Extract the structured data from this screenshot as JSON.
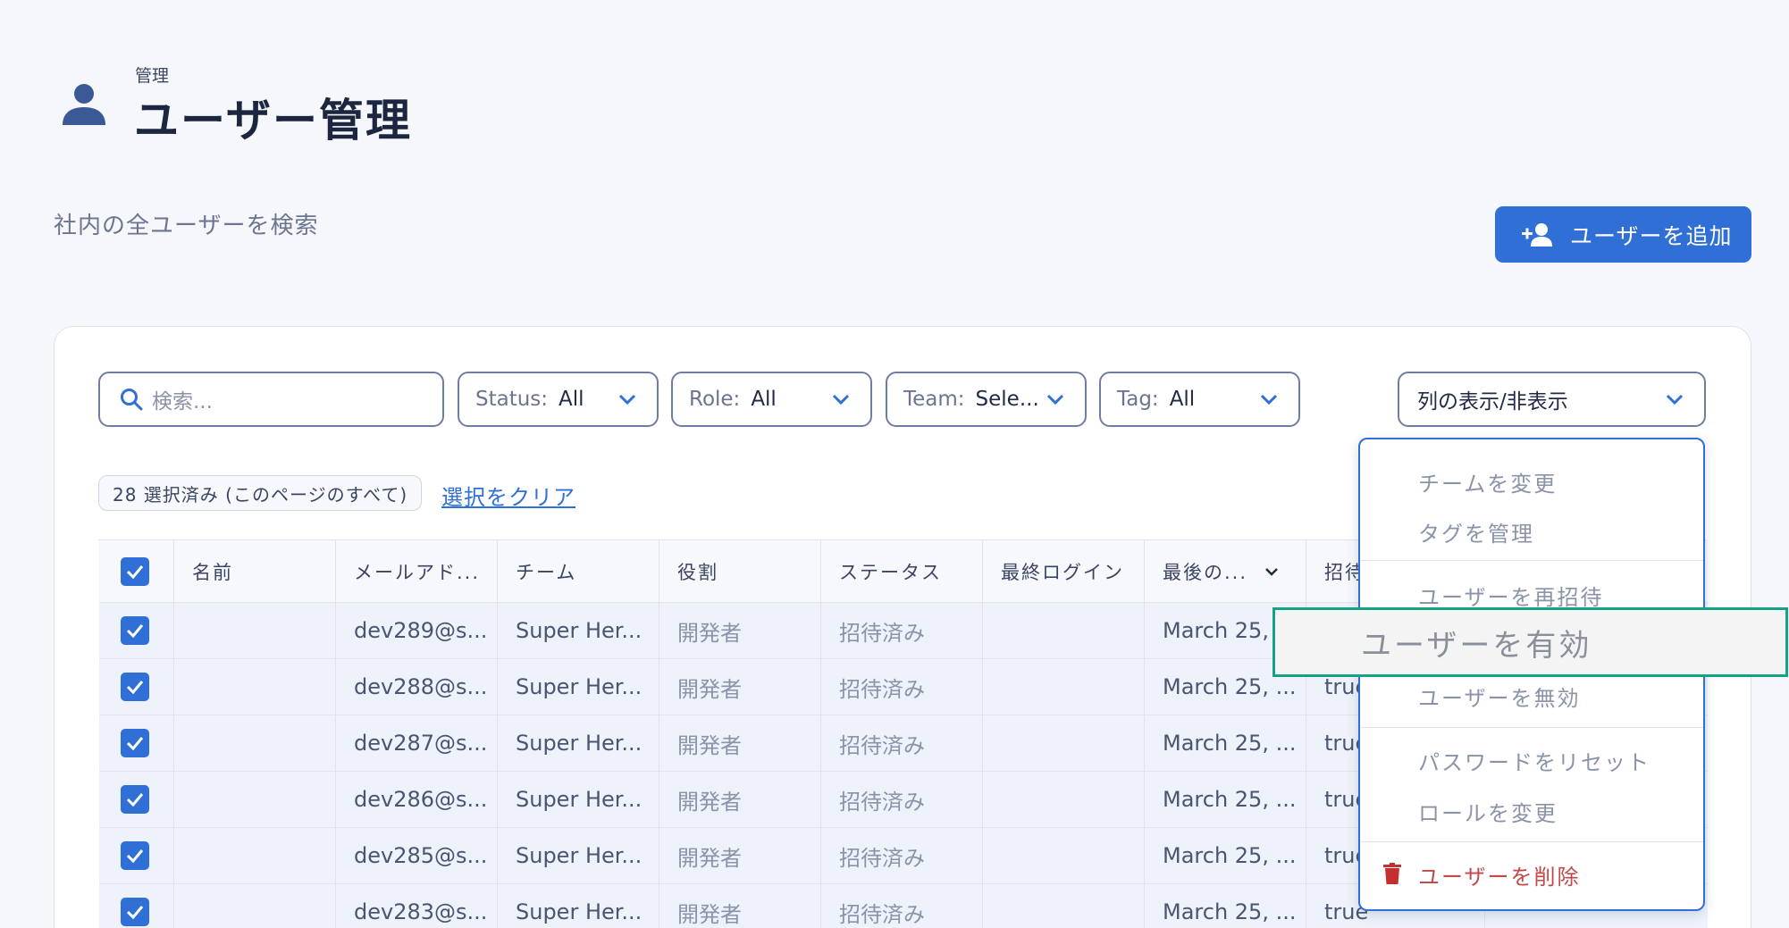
{
  "header": {
    "breadcrumb": "管理",
    "title": "ユーザー管理",
    "subtitle": "社内の全ユーザーを検索",
    "add_button_label": "ユーザーを追加",
    "icon": "user-icon"
  },
  "toolbar": {
    "search_placeholder": "検索...",
    "filters": [
      {
        "label": "Status:",
        "value": "All"
      },
      {
        "label": "Role:",
        "value": "All"
      },
      {
        "label": "Team:",
        "value": "Sele..."
      },
      {
        "label": "Tag:",
        "value": "All"
      }
    ],
    "columns_toggle_label": "列の表示/非表示"
  },
  "selection": {
    "badge": "28 選択済み (このページのすべて)",
    "clear_label": "選択をクリア"
  },
  "table": {
    "headers": [
      "名前",
      "メールアド...",
      "チーム",
      "役割",
      "ステータス",
      "最終ログイン",
      "最後の...",
      "招待"
    ],
    "rows": [
      {
        "name": "",
        "email": "dev289@s...",
        "team": "Super Her...",
        "role": "開発者",
        "status": "招待済み",
        "last_login": "",
        "last": "March 25, ...",
        "invite": ""
      },
      {
        "name": "",
        "email": "dev288@s...",
        "team": "Super Her...",
        "role": "開発者",
        "status": "招待済み",
        "last_login": "",
        "last": "March 25, ...",
        "invite": "true"
      },
      {
        "name": "",
        "email": "dev287@s...",
        "team": "Super Her...",
        "role": "開発者",
        "status": "招待済み",
        "last_login": "",
        "last": "March 25, ...",
        "invite": "true"
      },
      {
        "name": "",
        "email": "dev286@s...",
        "team": "Super Her...",
        "role": "開発者",
        "status": "招待済み",
        "last_login": "",
        "last": "March 25, ...",
        "invite": "true"
      },
      {
        "name": "",
        "email": "dev285@s...",
        "team": "Super Her...",
        "role": "開発者",
        "status": "招待済み",
        "last_login": "",
        "last": "March 25, ...",
        "invite": "true"
      },
      {
        "name": "",
        "email": "dev283@s...",
        "team": "Super Her...",
        "role": "開発者",
        "status": "招待済み",
        "last_login": "",
        "last": "March 25, ...",
        "invite": "true"
      }
    ]
  },
  "bulk_menu": {
    "items": [
      "チームを変更",
      "タグを管理",
      "ユーザーを再招待",
      "ユーザーを有効",
      "ユーザーを無効",
      "パスワードをリセット",
      "ロールを変更",
      "ユーザーを削除"
    ],
    "highlighted": "ユーザーを有効"
  },
  "colors": {
    "accent": "#2f6fd6",
    "danger": "#c24a4a",
    "highlight_border": "#14a383"
  }
}
